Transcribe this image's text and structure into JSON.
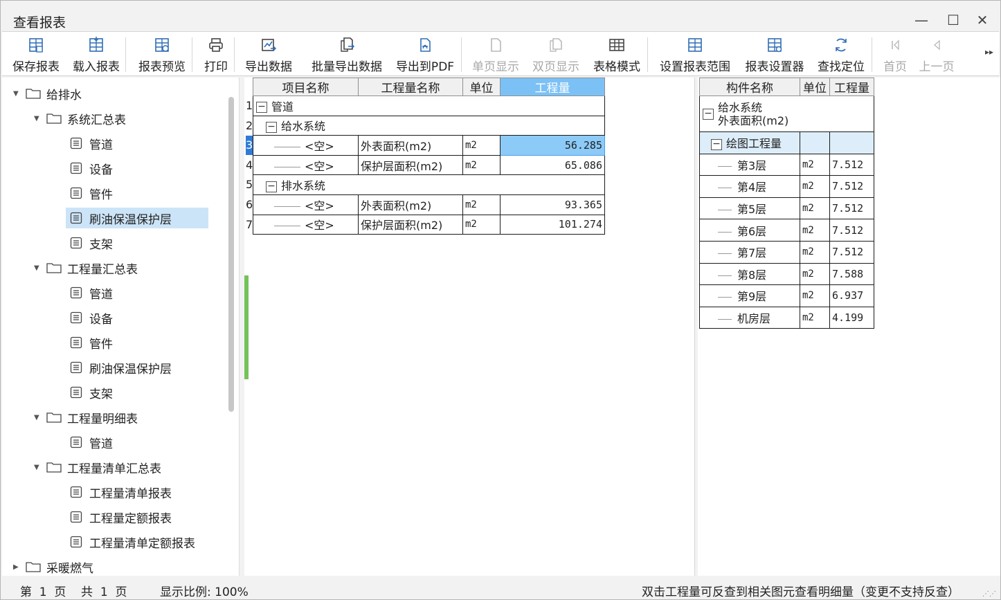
{
  "window": {
    "title": "查看报表",
    "minimize_glyph": "—",
    "maximize_glyph": "☐",
    "close_glyph": "✕"
  },
  "toolbar": {
    "items": [
      {
        "label": "保存报表",
        "icon": "save-report-icon",
        "enabled": true
      },
      {
        "label": "载入报表",
        "icon": "load-report-icon",
        "enabled": true
      },
      {
        "label": "报表预览",
        "icon": "preview-report-icon",
        "enabled": true
      },
      {
        "label": "打印",
        "icon": "printer-icon",
        "enabled": true
      },
      {
        "label": "导出数据",
        "icon": "export-data-icon",
        "enabled": true
      },
      {
        "label": "批量导出数据",
        "icon": "batch-export-icon",
        "enabled": true
      },
      {
        "label": "导出到PDF",
        "icon": "pdf-export-icon",
        "enabled": true
      },
      {
        "label": "单页显示",
        "icon": "single-page-icon",
        "enabled": false
      },
      {
        "label": "双页显示",
        "icon": "double-page-icon",
        "enabled": false
      },
      {
        "label": "表格模式",
        "icon": "table-mode-icon",
        "enabled": true
      },
      {
        "label": "设置报表范围",
        "icon": "report-range-icon",
        "enabled": true
      },
      {
        "label": "报表设置器",
        "icon": "report-settings-icon",
        "enabled": true
      },
      {
        "label": "查找定位",
        "icon": "find-locate-icon",
        "enabled": true
      },
      {
        "label": "首页",
        "icon": "first-page-icon",
        "enabled": false
      },
      {
        "label": "上一页",
        "icon": "prev-page-icon",
        "enabled": false
      }
    ],
    "more_glyph": "▸▸"
  },
  "tree": {
    "root": "给排水",
    "groups": [
      {
        "label": "系统汇总表",
        "items": [
          "管道",
          "设备",
          "管件",
          "刷油保温保护层",
          "支架"
        ]
      },
      {
        "label": "工程量汇总表",
        "items": [
          "管道",
          "设备",
          "管件",
          "刷油保温保护层",
          "支架"
        ]
      },
      {
        "label": "工程量明细表",
        "items": [
          "管道"
        ]
      },
      {
        "label": "工程量清单汇总表",
        "items": [
          "工程量清单报表",
          "工程量定额报表",
          "工程量清单定额报表"
        ]
      }
    ],
    "collapsed_root": "采暖燃气",
    "selected": "刷油保温保护层"
  },
  "main_table": {
    "headers": [
      "项目名称",
      "工程量名称",
      "单位",
      "工程量"
    ],
    "row_numbers": [
      "1",
      "2",
      "3",
      "4",
      "5",
      "6",
      "7"
    ],
    "rows": [
      {
        "type": "group",
        "level": 0,
        "label": "管道"
      },
      {
        "type": "group",
        "level": 1,
        "label": "给水系统"
      },
      {
        "type": "data",
        "name": "<空>",
        "qty_name": "外表面积(m2)",
        "unit": "m2",
        "value": "56.285",
        "selected": true
      },
      {
        "type": "data",
        "name": "<空>",
        "qty_name": "保护层面积(m2)",
        "unit": "m2",
        "value": "65.086"
      },
      {
        "type": "group",
        "level": 1,
        "label": "排水系统"
      },
      {
        "type": "data",
        "name": "<空>",
        "qty_name": "外表面积(m2)",
        "unit": "m2",
        "value": "93.365"
      },
      {
        "type": "data",
        "name": "<空>",
        "qty_name": "保护层面积(m2)",
        "unit": "m2",
        "value": "101.274"
      }
    ]
  },
  "detail_table": {
    "headers": [
      "构件名称",
      "单位",
      "工程量"
    ],
    "group_line1": "给水系统",
    "group_line2": "外表面积(m2)",
    "subgroup": "绘图工程量",
    "rows": [
      {
        "name": "第3层",
        "unit": "m2",
        "value": "7.512"
      },
      {
        "name": "第4层",
        "unit": "m2",
        "value": "7.512"
      },
      {
        "name": "第5层",
        "unit": "m2",
        "value": "7.512"
      },
      {
        "name": "第6层",
        "unit": "m2",
        "value": "7.512"
      },
      {
        "name": "第7层",
        "unit": "m2",
        "value": "7.512"
      },
      {
        "name": "第8层",
        "unit": "m2",
        "value": "7.588"
      },
      {
        "name": "第9层",
        "unit": "m2",
        "value": "6.937"
      },
      {
        "name": "机房层",
        "unit": "m2",
        "value": "4.199"
      }
    ]
  },
  "status": {
    "page_info": "第  1  页    共  1  页",
    "zoom": "显示比例: 100%",
    "hint": "双击工程量可反查到相关图元查看明细量（变更不支持反查）"
  }
}
